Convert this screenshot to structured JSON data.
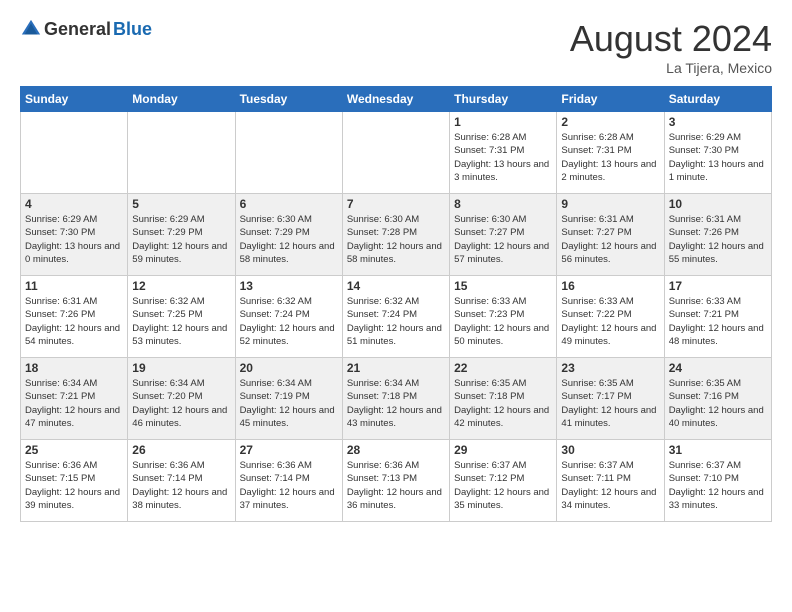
{
  "header": {
    "logo_general": "General",
    "logo_blue": "Blue",
    "month_title": "August 2024",
    "subtitle": "La Tijera, Mexico"
  },
  "days_of_week": [
    "Sunday",
    "Monday",
    "Tuesday",
    "Wednesday",
    "Thursday",
    "Friday",
    "Saturday"
  ],
  "weeks": [
    {
      "row_class": "row-odd",
      "days": [
        {
          "num": "",
          "info": "",
          "empty": true
        },
        {
          "num": "",
          "info": "",
          "empty": true
        },
        {
          "num": "",
          "info": "",
          "empty": true
        },
        {
          "num": "",
          "info": "",
          "empty": true
        },
        {
          "num": "1",
          "info": "Sunrise: 6:28 AM\nSunset: 7:31 PM\nDaylight: 13 hours and 3 minutes."
        },
        {
          "num": "2",
          "info": "Sunrise: 6:28 AM\nSunset: 7:31 PM\nDaylight: 13 hours and 2 minutes."
        },
        {
          "num": "3",
          "info": "Sunrise: 6:29 AM\nSunset: 7:30 PM\nDaylight: 13 hours and 1 minute."
        }
      ]
    },
    {
      "row_class": "row-even",
      "days": [
        {
          "num": "4",
          "info": "Sunrise: 6:29 AM\nSunset: 7:30 PM\nDaylight: 13 hours and 0 minutes."
        },
        {
          "num": "5",
          "info": "Sunrise: 6:29 AM\nSunset: 7:29 PM\nDaylight: 12 hours and 59 minutes."
        },
        {
          "num": "6",
          "info": "Sunrise: 6:30 AM\nSunset: 7:29 PM\nDaylight: 12 hours and 58 minutes."
        },
        {
          "num": "7",
          "info": "Sunrise: 6:30 AM\nSunset: 7:28 PM\nDaylight: 12 hours and 58 minutes."
        },
        {
          "num": "8",
          "info": "Sunrise: 6:30 AM\nSunset: 7:27 PM\nDaylight: 12 hours and 57 minutes."
        },
        {
          "num": "9",
          "info": "Sunrise: 6:31 AM\nSunset: 7:27 PM\nDaylight: 12 hours and 56 minutes."
        },
        {
          "num": "10",
          "info": "Sunrise: 6:31 AM\nSunset: 7:26 PM\nDaylight: 12 hours and 55 minutes."
        }
      ]
    },
    {
      "row_class": "row-odd",
      "days": [
        {
          "num": "11",
          "info": "Sunrise: 6:31 AM\nSunset: 7:26 PM\nDaylight: 12 hours and 54 minutes."
        },
        {
          "num": "12",
          "info": "Sunrise: 6:32 AM\nSunset: 7:25 PM\nDaylight: 12 hours and 53 minutes."
        },
        {
          "num": "13",
          "info": "Sunrise: 6:32 AM\nSunset: 7:24 PM\nDaylight: 12 hours and 52 minutes."
        },
        {
          "num": "14",
          "info": "Sunrise: 6:32 AM\nSunset: 7:24 PM\nDaylight: 12 hours and 51 minutes."
        },
        {
          "num": "15",
          "info": "Sunrise: 6:33 AM\nSunset: 7:23 PM\nDaylight: 12 hours and 50 minutes."
        },
        {
          "num": "16",
          "info": "Sunrise: 6:33 AM\nSunset: 7:22 PM\nDaylight: 12 hours and 49 minutes."
        },
        {
          "num": "17",
          "info": "Sunrise: 6:33 AM\nSunset: 7:21 PM\nDaylight: 12 hours and 48 minutes."
        }
      ]
    },
    {
      "row_class": "row-even",
      "days": [
        {
          "num": "18",
          "info": "Sunrise: 6:34 AM\nSunset: 7:21 PM\nDaylight: 12 hours and 47 minutes."
        },
        {
          "num": "19",
          "info": "Sunrise: 6:34 AM\nSunset: 7:20 PM\nDaylight: 12 hours and 46 minutes."
        },
        {
          "num": "20",
          "info": "Sunrise: 6:34 AM\nSunset: 7:19 PM\nDaylight: 12 hours and 45 minutes."
        },
        {
          "num": "21",
          "info": "Sunrise: 6:34 AM\nSunset: 7:18 PM\nDaylight: 12 hours and 43 minutes."
        },
        {
          "num": "22",
          "info": "Sunrise: 6:35 AM\nSunset: 7:18 PM\nDaylight: 12 hours and 42 minutes."
        },
        {
          "num": "23",
          "info": "Sunrise: 6:35 AM\nSunset: 7:17 PM\nDaylight: 12 hours and 41 minutes."
        },
        {
          "num": "24",
          "info": "Sunrise: 6:35 AM\nSunset: 7:16 PM\nDaylight: 12 hours and 40 minutes."
        }
      ]
    },
    {
      "row_class": "row-odd",
      "days": [
        {
          "num": "25",
          "info": "Sunrise: 6:36 AM\nSunset: 7:15 PM\nDaylight: 12 hours and 39 minutes."
        },
        {
          "num": "26",
          "info": "Sunrise: 6:36 AM\nSunset: 7:14 PM\nDaylight: 12 hours and 38 minutes."
        },
        {
          "num": "27",
          "info": "Sunrise: 6:36 AM\nSunset: 7:14 PM\nDaylight: 12 hours and 37 minutes."
        },
        {
          "num": "28",
          "info": "Sunrise: 6:36 AM\nSunset: 7:13 PM\nDaylight: 12 hours and 36 minutes."
        },
        {
          "num": "29",
          "info": "Sunrise: 6:37 AM\nSunset: 7:12 PM\nDaylight: 12 hours and 35 minutes."
        },
        {
          "num": "30",
          "info": "Sunrise: 6:37 AM\nSunset: 7:11 PM\nDaylight: 12 hours and 34 minutes."
        },
        {
          "num": "31",
          "info": "Sunrise: 6:37 AM\nSunset: 7:10 PM\nDaylight: 12 hours and 33 minutes."
        }
      ]
    }
  ]
}
